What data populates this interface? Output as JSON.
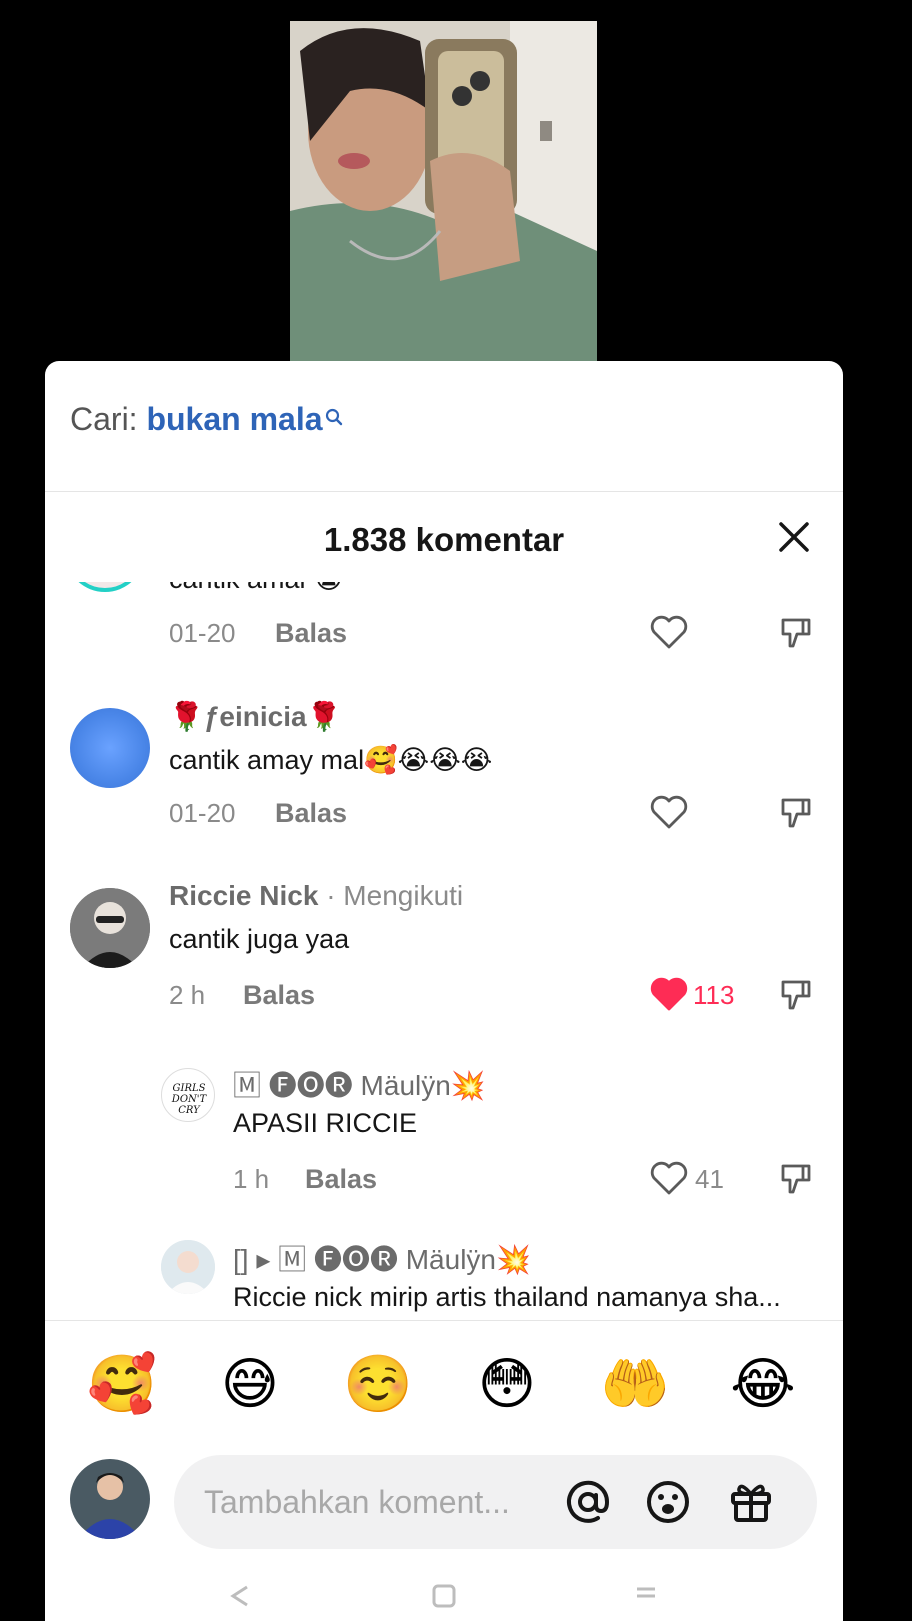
{
  "search": {
    "prefix": "Cari:",
    "query": "bukan mala"
  },
  "header": {
    "title": "1.838 komentar"
  },
  "comments": [
    {
      "text": "cantik amai 😭",
      "time": "01-20",
      "reply": "Balas"
    },
    {
      "user": "🌹ƒeinicia🌹",
      "text": "cantik amay mal🥰😭😭😭",
      "time": "01-20",
      "reply": "Balas"
    },
    {
      "user": "Riccie Nick",
      "follow": "· Mengikuti",
      "text": "cantik juga yaa",
      "time": "2 h",
      "reply": "Balas",
      "likes": "113"
    },
    {
      "user": "🄼 🅕🅞🅡 Mäulÿn💥",
      "text": "APASII RICCIE",
      "time": "1 h",
      "reply": "Balas",
      "likes": "41"
    },
    {
      "user": "[] ▸ 🄼 🅕🅞🅡 Mäulÿn💥",
      "text": "Riccie nick mirip artis thailand namanya sha..."
    }
  ],
  "emoji_bar": [
    "🥰",
    "😅",
    "☺️",
    "😳",
    "🤲",
    "😂"
  ],
  "composer": {
    "placeholder": "Tambahkan koment..."
  },
  "colors": {
    "accent_blue": "#2e64b7",
    "like_red": "#fe2c55"
  }
}
